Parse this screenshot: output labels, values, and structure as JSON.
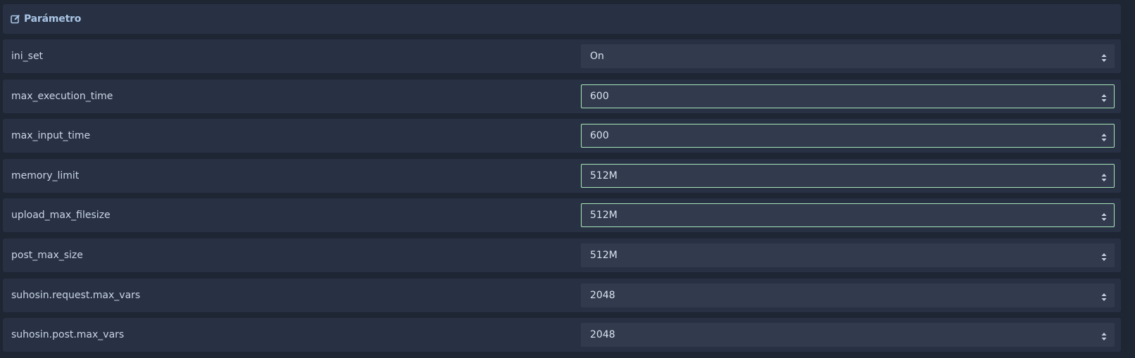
{
  "header": {
    "title": "Parámetro",
    "icon": "edit-icon"
  },
  "params": [
    {
      "label": "ini_set",
      "value": "On",
      "focused": false
    },
    {
      "label": "max_execution_time",
      "value": "600",
      "focused": true
    },
    {
      "label": "max_input_time",
      "value": "600",
      "focused": true
    },
    {
      "label": "memory_limit",
      "value": "512M",
      "focused": true
    },
    {
      "label": "upload_max_filesize",
      "value": "512M",
      "focused": true
    },
    {
      "label": "post_max_size",
      "value": "512M",
      "focused": false
    },
    {
      "label": "suhosin.request.max_vars",
      "value": "2048",
      "focused": false
    },
    {
      "label": "suhosin.post.max_vars",
      "value": "2048",
      "focused": false
    }
  ],
  "colors": {
    "background": "#1e2533",
    "row": "#283143",
    "select": "#323b4d",
    "focus_border": "#a8e6b8",
    "accent_text": "#a9c4e4"
  }
}
